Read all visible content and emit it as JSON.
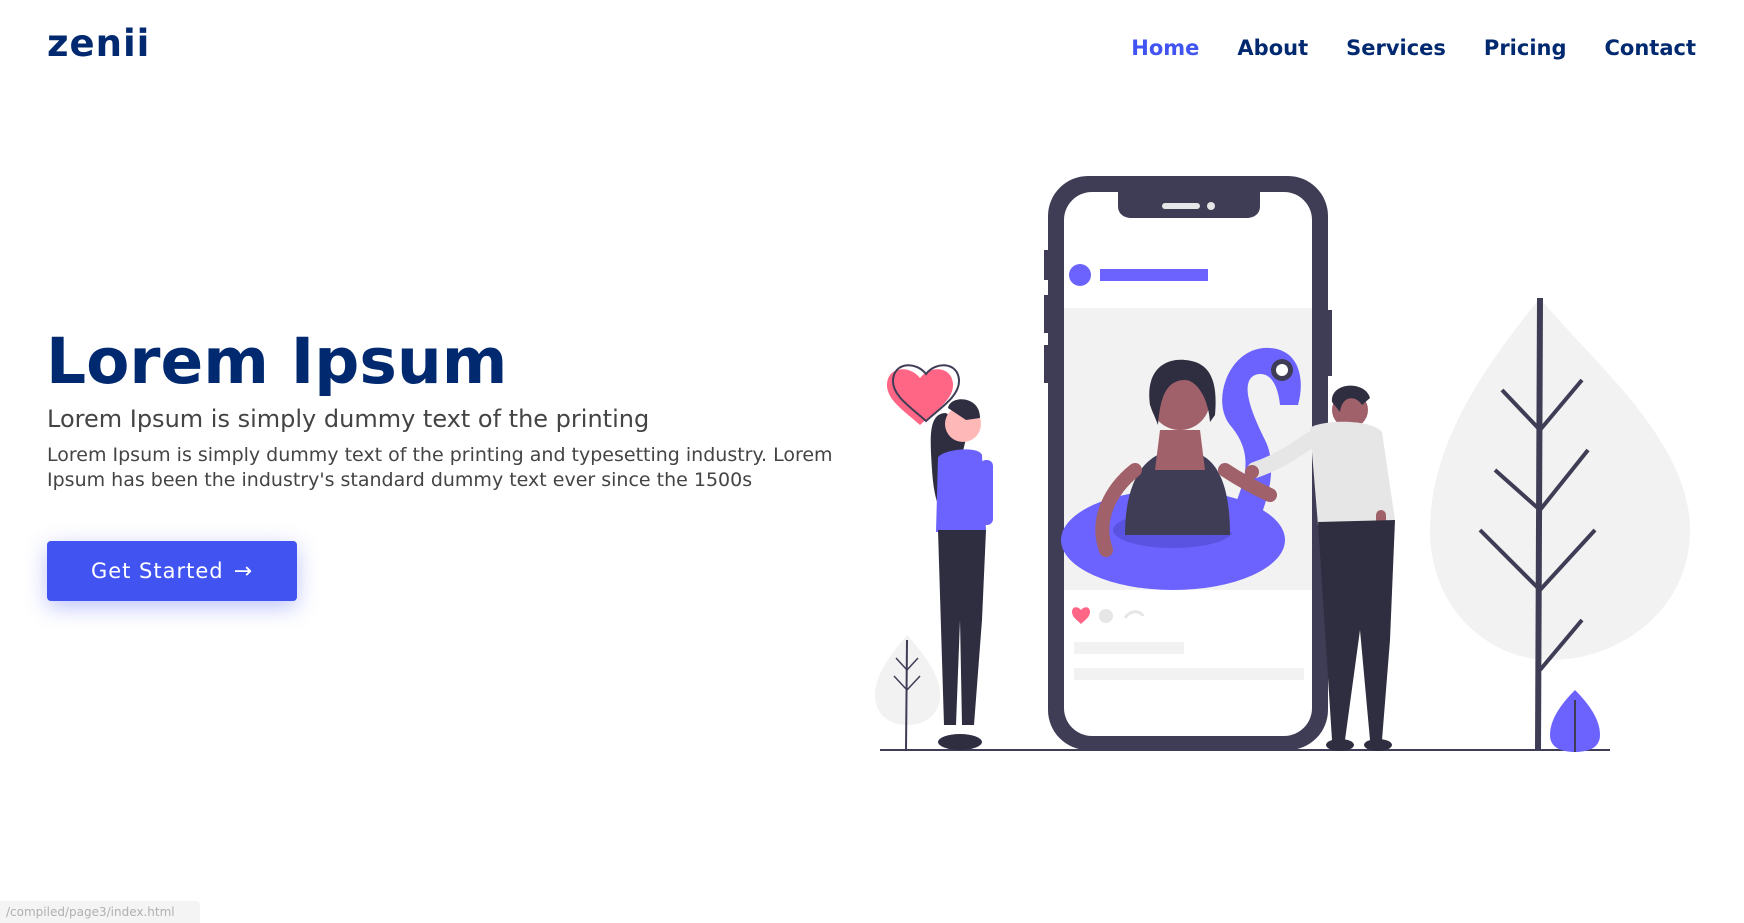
{
  "brand": {
    "name": "zenii"
  },
  "nav": {
    "items": [
      {
        "label": "Home",
        "active": true
      },
      {
        "label": "About",
        "active": false
      },
      {
        "label": "Services",
        "active": false
      },
      {
        "label": "Pricing",
        "active": false
      },
      {
        "label": "Contact",
        "active": false
      }
    ]
  },
  "hero": {
    "title": "Lorem Ipsum",
    "subtitle": "Lorem Ipsum is simply dummy text of the printing",
    "description": "Lorem Ipsum is simply dummy text of the printing and typesetting industry. Lorem Ipsum has been the industry's standard dummy text ever since the 1500s",
    "cta_label": "Get Started",
    "cta_icon": "arrow-right-icon"
  },
  "status_bar": {
    "url": "/compiled/page3/index.html"
  },
  "colors": {
    "primary": "#4154f1",
    "navy": "#012970",
    "illustration_purple": "#6c63ff",
    "illustration_dark": "#3f3d56",
    "heart_pink": "#ff6584"
  }
}
